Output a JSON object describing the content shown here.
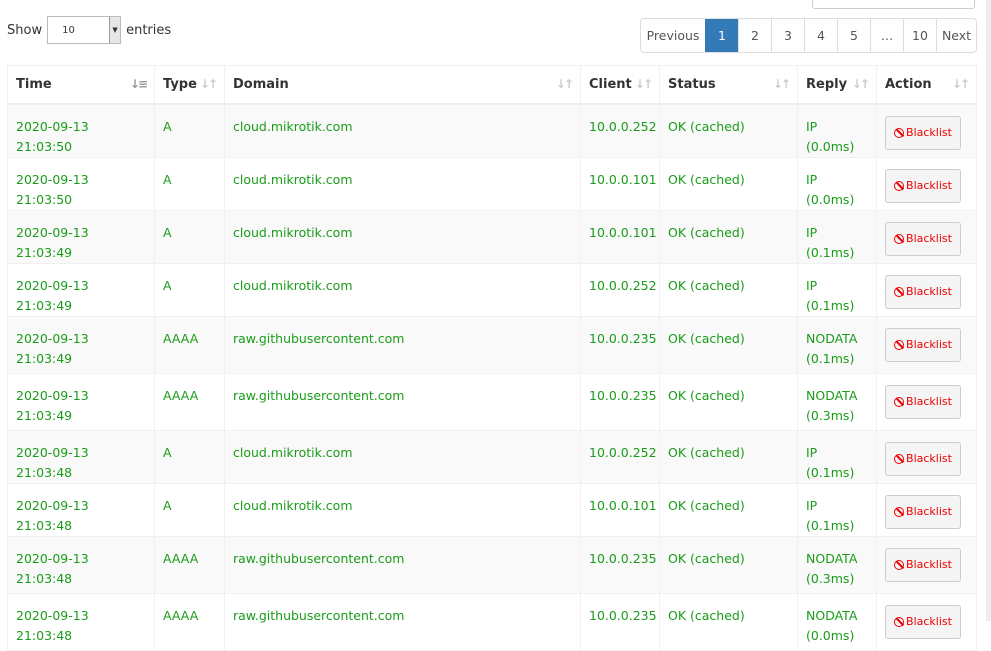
{
  "length": {
    "show": "Show",
    "value": "10",
    "entries": "entries"
  },
  "pagination": {
    "previous": "Previous",
    "pages": [
      "1",
      "2",
      "3",
      "4",
      "5",
      "…",
      "10"
    ],
    "active": "1",
    "next": "Next"
  },
  "columns": [
    "Time",
    "Type",
    "Domain",
    "Client",
    "Status",
    "Reply",
    "Action"
  ],
  "action_label": "Blacklist",
  "rows": [
    {
      "time": "2020-09-13 21:03:50",
      "type": "A",
      "domain": "cloud.mikrotik.com",
      "client": "10.0.0.252",
      "status": "OK (cached)",
      "reply": "IP (0.0ms)"
    },
    {
      "time": "2020-09-13 21:03:50",
      "type": "A",
      "domain": "cloud.mikrotik.com",
      "client": "10.0.0.101",
      "status": "OK (cached)",
      "reply": "IP (0.0ms)"
    },
    {
      "time": "2020-09-13 21:03:49",
      "type": "A",
      "domain": "cloud.mikrotik.com",
      "client": "10.0.0.101",
      "status": "OK (cached)",
      "reply": "IP (0.1ms)"
    },
    {
      "time": "2020-09-13 21:03:49",
      "type": "A",
      "domain": "cloud.mikrotik.com",
      "client": "10.0.0.252",
      "status": "OK (cached)",
      "reply": "IP (0.1ms)"
    },
    {
      "time": "2020-09-13 21:03:49",
      "type": "AAAA",
      "domain": "raw.githubusercontent.com",
      "client": "10.0.0.235",
      "status": "OK (cached)",
      "reply": "NODATA (0.1ms)"
    },
    {
      "time": "2020-09-13 21:03:49",
      "type": "AAAA",
      "domain": "raw.githubusercontent.com",
      "client": "10.0.0.235",
      "status": "OK (cached)",
      "reply": "NODATA (0.3ms)"
    },
    {
      "time": "2020-09-13 21:03:48",
      "type": "A",
      "domain": "cloud.mikrotik.com",
      "client": "10.0.0.252",
      "status": "OK (cached)",
      "reply": "IP (0.1ms)"
    },
    {
      "time": "2020-09-13 21:03:48",
      "type": "A",
      "domain": "cloud.mikrotik.com",
      "client": "10.0.0.101",
      "status": "OK (cached)",
      "reply": "IP (0.1ms)"
    },
    {
      "time": "2020-09-13 21:03:48",
      "type": "AAAA",
      "domain": "raw.githubusercontent.com",
      "client": "10.0.0.235",
      "status": "OK (cached)",
      "reply": "NODATA (0.3ms)"
    },
    {
      "time": "2020-09-13 21:03:48",
      "type": "AAAA",
      "domain": "raw.githubusercontent.com",
      "client": "10.0.0.235",
      "status": "OK (cached)",
      "reply": "NODATA (0.0ms)"
    }
  ]
}
